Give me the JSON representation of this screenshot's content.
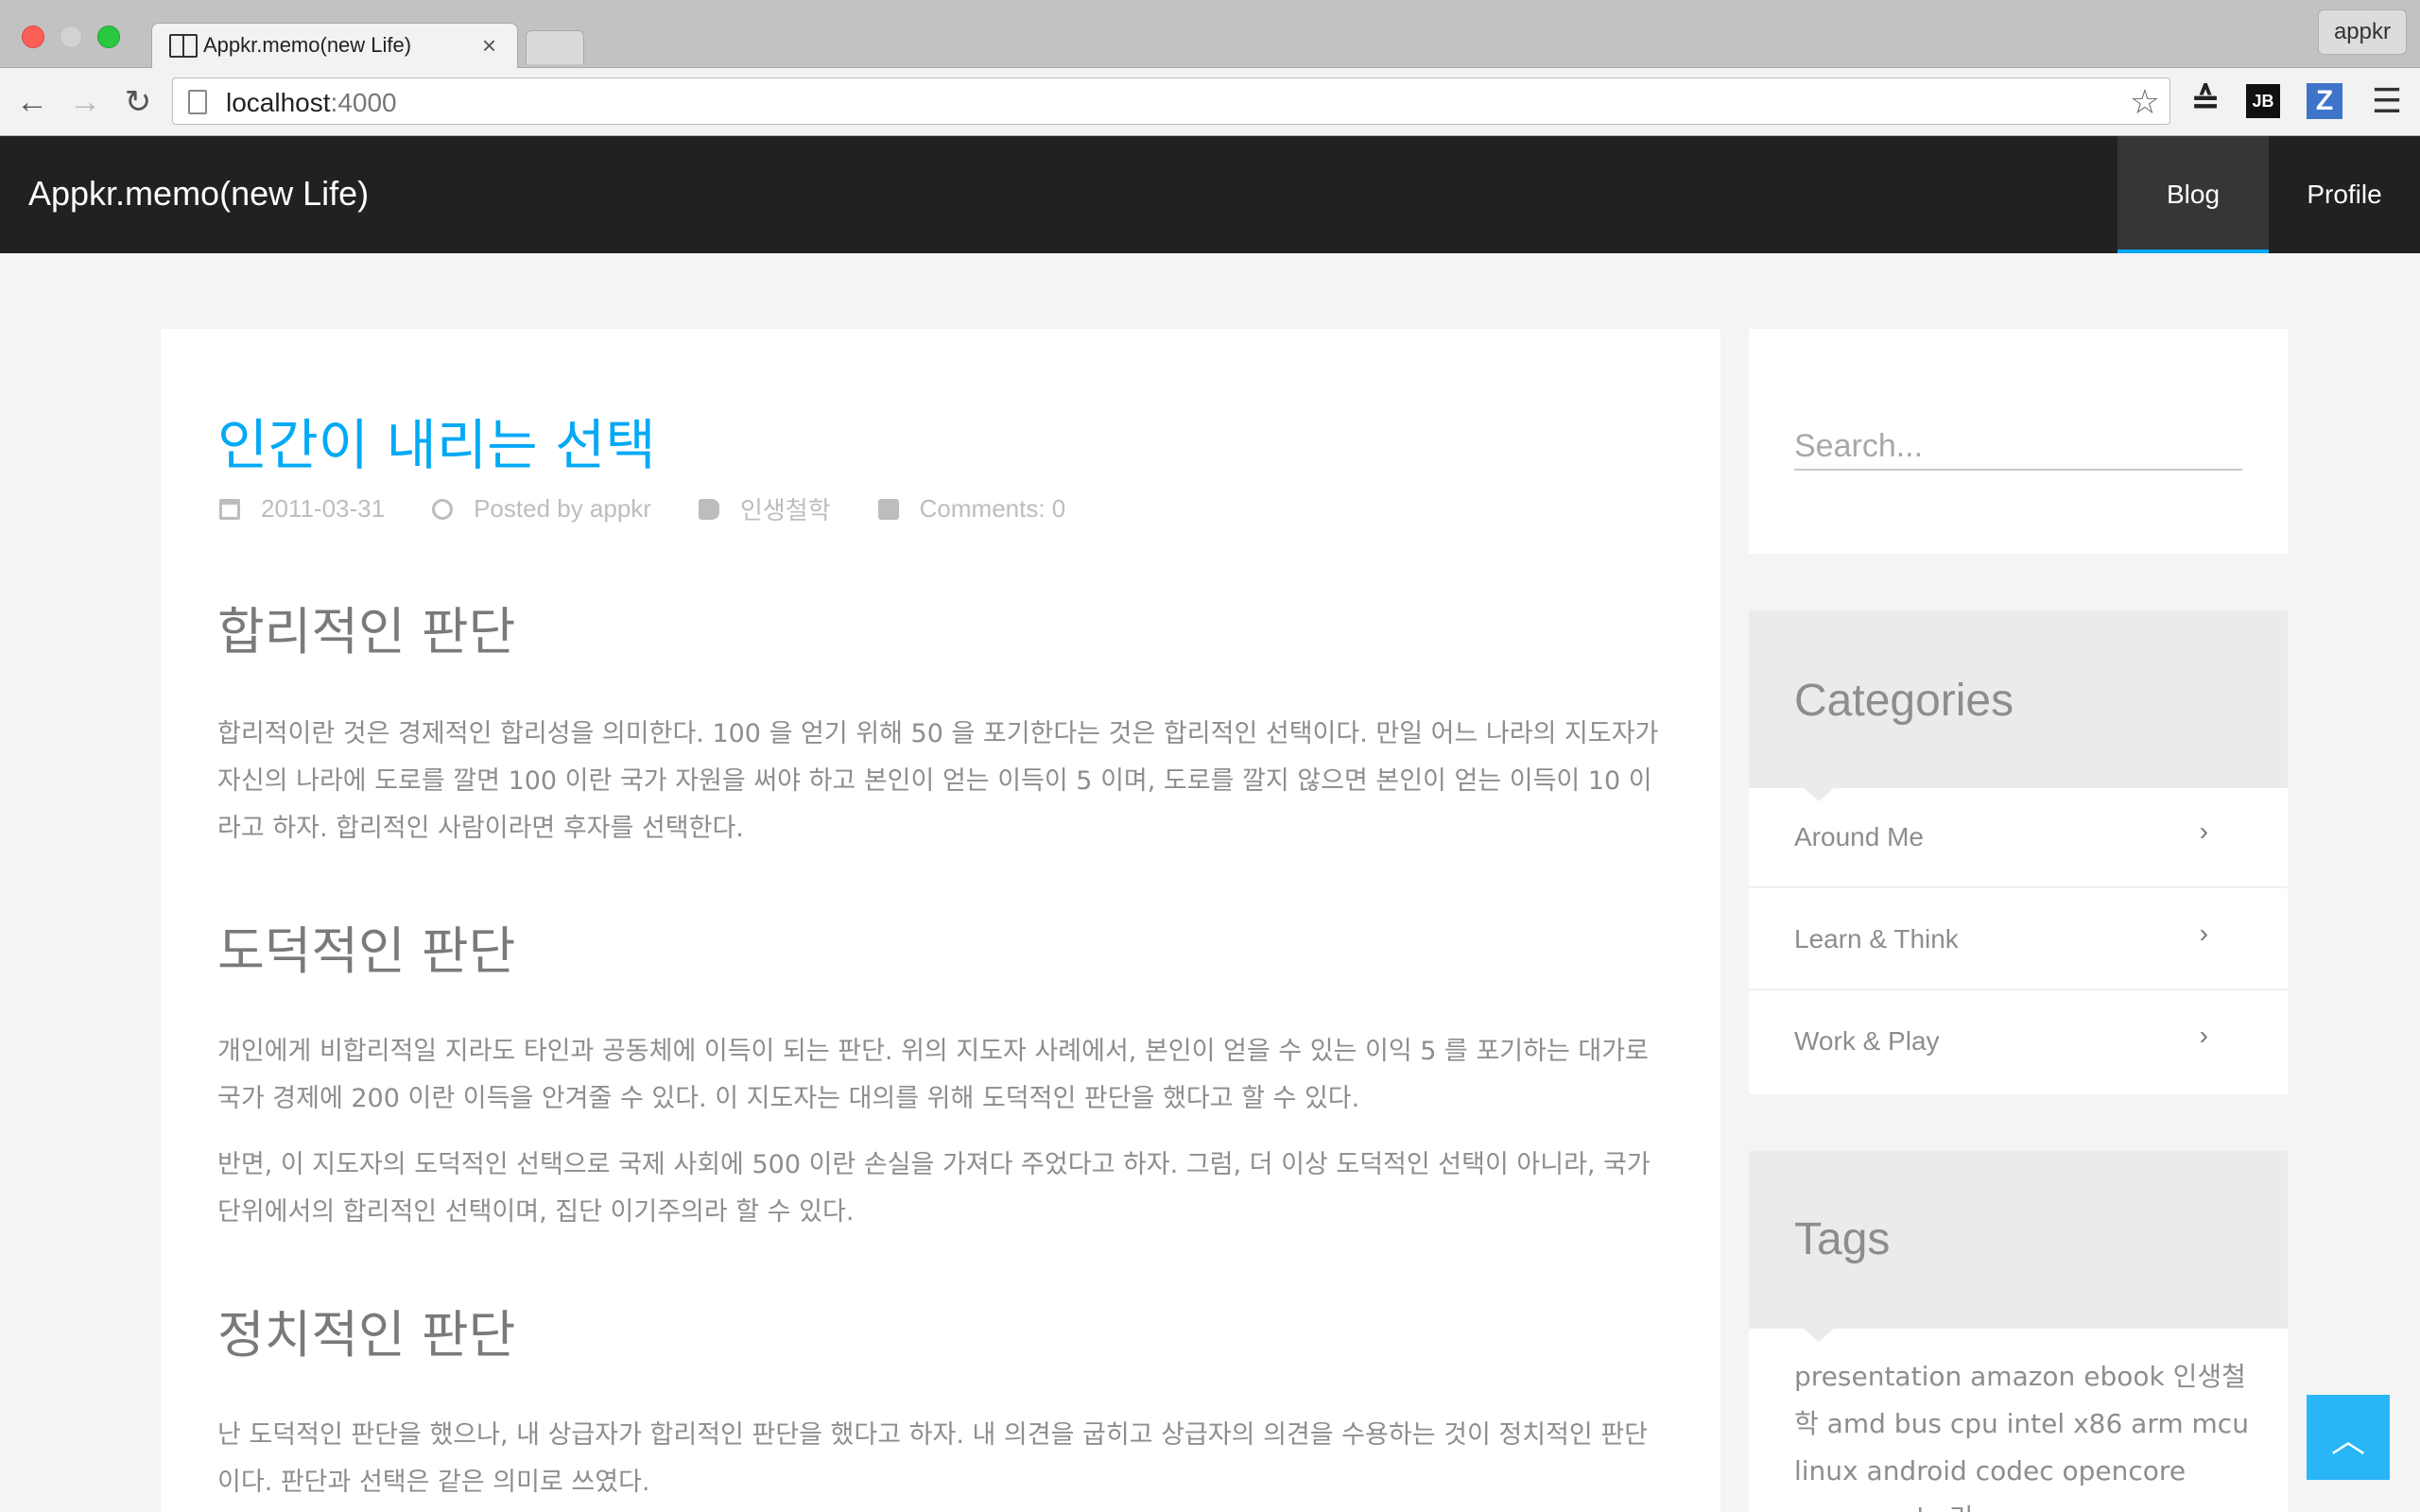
{
  "browser": {
    "tab_title": "Appkr.memo(new Life)",
    "url_host": "localhost",
    "url_port": ":4000",
    "profile_name": "appkr",
    "ext_jb": "JB",
    "ext_z": "Z"
  },
  "navbar": {
    "brand": "Appkr.memo(new Life)",
    "items": [
      {
        "label": "Blog",
        "active": true
      },
      {
        "label": "Profile",
        "active": false
      }
    ],
    "active_color": "#03a9f4"
  },
  "post": {
    "title": "인간이 내리는 선택",
    "date": "2011-03-31",
    "author": "Posted by appkr",
    "category": "인생철학",
    "comments": "Comments: 0",
    "sections": [
      {
        "heading": "합리적인 판단",
        "paragraphs": [
          "합리적이란 것은 경제적인 합리성을 의미한다. 100 을 얻기 위해 50 을 포기한다는 것은 합리적인 선택이다. 만일 어느 나라의 지도자가 자신의 나라에 도로를 깔면 100 이란 국가 자원을 써야 하고 본인이 얻는 이득이 5 이며, 도로를 깔지 않으면 본인이 얻는 이득이 10 이라고 하자. 합리적인 사람이라면 후자를 선택한다."
        ]
      },
      {
        "heading": "도덕적인 판단",
        "paragraphs": [
          "개인에게 비합리적일 지라도 타인과 공동체에 이득이 되는 판단. 위의 지도자 사례에서, 본인이 얻을 수 있는 이익 5 를 포기하는 대가로 국가 경제에 200 이란 이득을 안겨줄 수 있다. 이 지도자는 대의를 위해 도덕적인 판단을 했다고 할 수 있다.",
          "반면, 이 지도자의 도덕적인 선택으로 국제 사회에 500 이란 손실을 가져다 주었다고 하자. 그럼, 더 이상 도덕적인 선택이 아니라, 국가 단위에서의 합리적인 선택이며, 집단 이기주의라 할 수 있다."
        ]
      },
      {
        "heading": "정치적인 판단",
        "paragraphs": [
          "난 도덕적인 판단을 했으나, 내 상급자가 합리적인 판단을 했다고 하자. 내 의견을 굽히고 상급자의 의견을 수용하는 것이 정치적인 판단이다. 판단과 선택은 같은 의미로 쓰였다."
        ]
      }
    ]
  },
  "sidebar": {
    "search_placeholder": "Search...",
    "categories_title": "Categories",
    "categories": [
      {
        "label": "Around Me"
      },
      {
        "label": "Learn & Think"
      },
      {
        "label": "Work & Play"
      }
    ],
    "tags_title": "Tags",
    "tags": [
      "presentation",
      "amazon",
      "ebook",
      "인생철학",
      "amd",
      "bus",
      "cpu",
      "intel",
      "x86",
      "arm",
      "mcu",
      "linux",
      "android",
      "codec",
      "opencore",
      "pvcore",
      "cdp",
      "리"
    ]
  },
  "back_to_top": "^"
}
